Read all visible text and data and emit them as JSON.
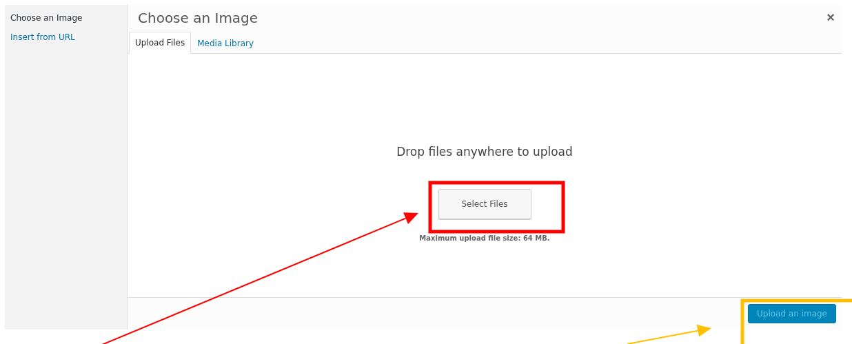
{
  "sidebar": {
    "items": [
      {
        "label": "Choose an Image",
        "selected": true
      },
      {
        "label": "Insert from URL",
        "selected": false
      }
    ]
  },
  "modal": {
    "title": "Choose an Image",
    "close": "×"
  },
  "tabs": [
    {
      "label": "Upload Files",
      "selected": true
    },
    {
      "label": "Media Library",
      "selected": false
    }
  ],
  "uploader": {
    "heading": "Drop files anywhere to upload",
    "button": "Select Files",
    "note": "Maximum upload file size: 64 MB."
  },
  "footer": {
    "button": "Upload an image",
    "disabled": true
  },
  "annotations": [
    {
      "kind": "frame",
      "color": "#ff0000"
    },
    {
      "kind": "arrow",
      "color": "#ff0000"
    },
    {
      "kind": "frame",
      "color": "#ffc000"
    },
    {
      "kind": "arrow",
      "color": "#ffc000"
    }
  ]
}
